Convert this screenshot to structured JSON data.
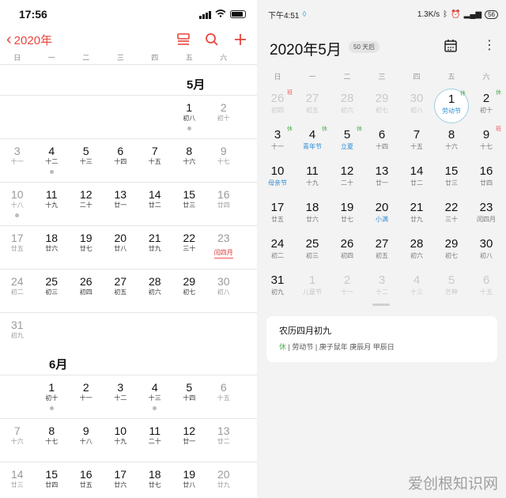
{
  "left": {
    "status_time": "17:56",
    "nav_back": "2020年",
    "weekdays": [
      "日",
      "一",
      "二",
      "三",
      "四",
      "五",
      "六"
    ],
    "may_label": "5月",
    "june_label": "6月",
    "may_rows": [
      [
        null,
        null,
        null,
        null,
        null,
        {
          "d": "1",
          "s": "初八",
          "dot": true
        },
        {
          "d": "2",
          "s": "初十"
        }
      ],
      [
        {
          "d": "3",
          "s": "十一"
        },
        {
          "d": "4",
          "s": "十二",
          "dot": true
        },
        {
          "d": "5",
          "s": "十三"
        },
        {
          "d": "6",
          "s": "十四"
        },
        {
          "d": "7",
          "s": "十五"
        },
        {
          "d": "8",
          "s": "十六"
        },
        {
          "d": "9",
          "s": "十七"
        }
      ],
      [
        {
          "d": "10",
          "s": "十八",
          "dot": true
        },
        {
          "d": "11",
          "s": "十九"
        },
        {
          "d": "12",
          "s": "二十"
        },
        {
          "d": "13",
          "s": "廿一"
        },
        {
          "d": "14",
          "s": "廿二"
        },
        {
          "d": "15",
          "s": "廿三"
        },
        {
          "d": "16",
          "s": "廿四"
        }
      ],
      [
        {
          "d": "17",
          "s": "廿五"
        },
        {
          "d": "18",
          "s": "廿六"
        },
        {
          "d": "19",
          "s": "廿七"
        },
        {
          "d": "20",
          "s": "廿八"
        },
        {
          "d": "21",
          "s": "廿九"
        },
        {
          "d": "22",
          "s": "三十"
        },
        {
          "d": "23",
          "s": "闰四月",
          "red": true
        }
      ],
      [
        {
          "d": "24",
          "s": "初二"
        },
        {
          "d": "25",
          "s": "初三"
        },
        {
          "d": "26",
          "s": "初四"
        },
        {
          "d": "27",
          "s": "初五"
        },
        {
          "d": "28",
          "s": "初六"
        },
        {
          "d": "29",
          "s": "初七"
        },
        {
          "d": "30",
          "s": "初八"
        }
      ],
      [
        {
          "d": "31",
          "s": "初九"
        },
        null,
        null,
        null,
        null,
        null,
        null
      ]
    ],
    "june_rows": [
      [
        null,
        {
          "d": "1",
          "s": "初十",
          "dot": true
        },
        {
          "d": "2",
          "s": "十一"
        },
        {
          "d": "3",
          "s": "十二"
        },
        {
          "d": "4",
          "s": "十三",
          "dot": true
        },
        {
          "d": "5",
          "s": "十四"
        },
        {
          "d": "6",
          "s": "十五"
        }
      ],
      [
        {
          "d": "7",
          "s": "十六"
        },
        {
          "d": "8",
          "s": "十七"
        },
        {
          "d": "9",
          "s": "十八"
        },
        {
          "d": "10",
          "s": "十九"
        },
        {
          "d": "11",
          "s": "二十"
        },
        {
          "d": "12",
          "s": "廿一"
        },
        {
          "d": "13",
          "s": "廿二"
        }
      ],
      [
        {
          "d": "14",
          "s": "廿三"
        },
        {
          "d": "15",
          "s": "廿四"
        },
        {
          "d": "16",
          "s": "廿五"
        },
        {
          "d": "17",
          "s": "廿六"
        },
        {
          "d": "18",
          "s": "廿七"
        },
        {
          "d": "19",
          "s": "廿八"
        },
        {
          "d": "20",
          "s": "廿九"
        }
      ]
    ]
  },
  "right": {
    "status_time": "下午4:51",
    "status_speed": "1.3K/s",
    "battery": "56",
    "title": "2020年5月",
    "badge": "50 天后",
    "weekdays": [
      "日",
      "一",
      "二",
      "三",
      "四",
      "五",
      "六"
    ],
    "rows": [
      [
        {
          "d": "26",
          "s": "初四",
          "faded": true,
          "tag": "班",
          "tagtype": "work"
        },
        {
          "d": "27",
          "s": "初五",
          "faded": true
        },
        {
          "d": "28",
          "s": "初六",
          "faded": true
        },
        {
          "d": "29",
          "s": "初七",
          "faded": true
        },
        {
          "d": "30",
          "s": "初八",
          "faded": true
        },
        {
          "d": "1",
          "s": "劳动节",
          "blue": true,
          "tag": "休",
          "tagtype": "rest",
          "sel": true
        },
        {
          "d": "2",
          "s": "初十",
          "tag": "休",
          "tagtype": "rest"
        }
      ],
      [
        {
          "d": "3",
          "s": "十一",
          "tag": "休",
          "tagtype": "rest"
        },
        {
          "d": "4",
          "s": "青年节",
          "blue": true,
          "tag": "休",
          "tagtype": "rest"
        },
        {
          "d": "5",
          "s": "立夏",
          "blue": true,
          "tag": "休",
          "tagtype": "rest"
        },
        {
          "d": "6",
          "s": "十四"
        },
        {
          "d": "7",
          "s": "十五"
        },
        {
          "d": "8",
          "s": "十六"
        },
        {
          "d": "9",
          "s": "十七",
          "tag": "班",
          "tagtype": "work"
        }
      ],
      [
        {
          "d": "10",
          "s": "母亲节",
          "blue": true
        },
        {
          "d": "11",
          "s": "十九"
        },
        {
          "d": "12",
          "s": "二十"
        },
        {
          "d": "13",
          "s": "廿一"
        },
        {
          "d": "14",
          "s": "廿二"
        },
        {
          "d": "15",
          "s": "廿三"
        },
        {
          "d": "16",
          "s": "廿四"
        }
      ],
      [
        {
          "d": "17",
          "s": "廿五"
        },
        {
          "d": "18",
          "s": "廿六"
        },
        {
          "d": "19",
          "s": "廿七"
        },
        {
          "d": "20",
          "s": "小满",
          "blue": true
        },
        {
          "d": "21",
          "s": "廿九"
        },
        {
          "d": "22",
          "s": "三十"
        },
        {
          "d": "23",
          "s": "闰四月"
        }
      ],
      [
        {
          "d": "24",
          "s": "初二"
        },
        {
          "d": "25",
          "s": "初三"
        },
        {
          "d": "26",
          "s": "初四"
        },
        {
          "d": "27",
          "s": "初五"
        },
        {
          "d": "28",
          "s": "初六"
        },
        {
          "d": "29",
          "s": "初七"
        },
        {
          "d": "30",
          "s": "初八"
        }
      ],
      [
        {
          "d": "31",
          "s": "初九"
        },
        {
          "d": "1",
          "s": "儿童节",
          "faded": true
        },
        {
          "d": "2",
          "s": "十一",
          "faded": true
        },
        {
          "d": "3",
          "s": "十二",
          "faded": true
        },
        {
          "d": "4",
          "s": "十三",
          "faded": true
        },
        {
          "d": "5",
          "s": "芒种",
          "faded": true
        },
        {
          "d": "6",
          "s": "十五",
          "faded": true
        }
      ]
    ],
    "card_title": "农历四月初九",
    "card_rest": "休",
    "card_info": "| 劳动节 | 庚子鼠年 庚辰月 甲辰日"
  },
  "watermark": "爱创根知识网"
}
